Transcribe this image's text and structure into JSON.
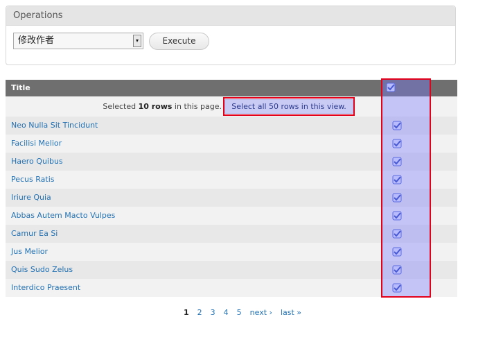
{
  "operations": {
    "title": "Operations",
    "select_value": "修改作者",
    "execute_label": "Execute"
  },
  "table": {
    "header_title": "Title",
    "selection": {
      "prefix": "Selected ",
      "count": "10 rows",
      "suffix": " in this page.",
      "select_all_label": "Select all 50 rows in this view."
    },
    "rows": [
      "Neo Nulla Sit Tincidunt",
      "Facilisi Melior",
      "Haero Quibus",
      "Pecus Ratis",
      "Iriure Quia",
      "Abbas Autem Macto Vulpes",
      "Camur Ea Si",
      "Jus Melior",
      "Quis Sudo Zelus",
      "Interdico Praesent"
    ]
  },
  "pager": {
    "pages": [
      "1",
      "2",
      "3",
      "4",
      "5"
    ],
    "current": "1",
    "next": "next ›",
    "last": "last »"
  },
  "colors": {
    "link": "#2271b3",
    "header_bg": "#6f6f6f",
    "highlight": "#7878ff",
    "annotation": "#e3001b"
  },
  "icons": {
    "check": "checkbox-checked-icon",
    "dropdown": "chevron-down-icon"
  }
}
